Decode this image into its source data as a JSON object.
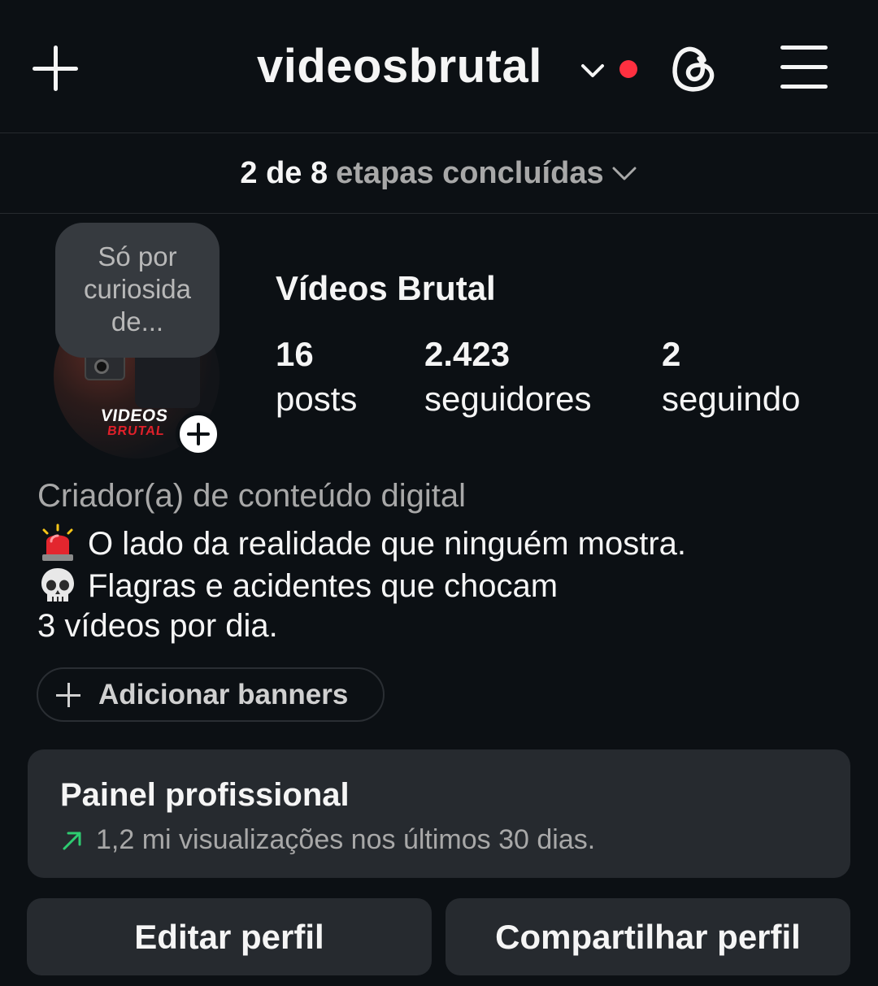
{
  "header": {
    "username": "videosbrutal",
    "icons": [
      "plus-icon",
      "chevron-down-icon",
      "notification-dot",
      "threads-icon",
      "menu-icon"
    ]
  },
  "onboarding": {
    "progress": "2 de 8",
    "suffix": "etapas concluídas"
  },
  "profile": {
    "note": "Só por curiosida de...",
    "display_name": "Vídeos Brutal",
    "stats": {
      "posts": {
        "value": "16",
        "label": "posts"
      },
      "followers": {
        "value": "2.423",
        "label": "seguidores"
      },
      "following": {
        "value": "2",
        "label": "seguindo"
      }
    },
    "avatar_text": {
      "line1": "VIDEOS",
      "line2": "BRUTAL"
    },
    "category": "Criador(a) de conteúdo digital",
    "bio": {
      "line1": "O lado da realidade que ninguém mostra.",
      "line2": "Flagras e acidentes que chocam",
      "line3": "3 vídeos por dia."
    },
    "bio_icons": [
      "siren-emoji",
      "skull-emoji"
    ]
  },
  "banners_button": "Adicionar banners",
  "dashboard": {
    "title": "Painel profissional",
    "subtitle": "1,2 mi visualizações nos últimos 30 dias."
  },
  "actions": {
    "edit": "Editar perfil",
    "share": "Compartilhar perfil"
  },
  "colors": {
    "background": "#0c1014",
    "card": "#262a2f",
    "notification": "#ff3040",
    "trend": "#2ecc71",
    "muted_text": "#a8a8a8"
  }
}
